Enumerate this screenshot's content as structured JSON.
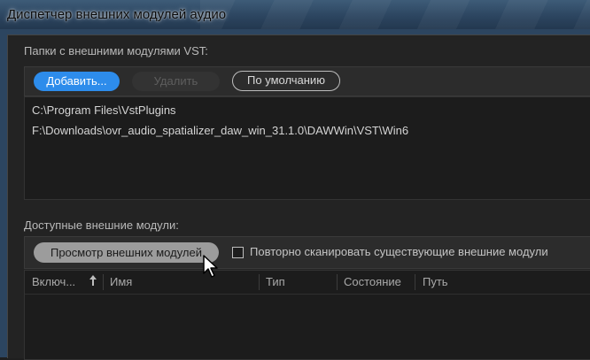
{
  "window": {
    "title": "Диспетчер внешних модулей аудио"
  },
  "vst_folders": {
    "section_label": "Папки с внешними модулями VST:",
    "add_button": "Добавить...",
    "remove_button": "Удалить",
    "default_button": "По умолчанию",
    "paths": [
      "C:\\Program Files\\VstPlugins",
      "F:\\Downloads\\ovr_audio_spatializer_daw_win_31.1.0\\DAWWin\\VST\\Win6"
    ]
  },
  "available_modules": {
    "section_label": "Доступные внешние модули:",
    "scan_button": "Просмотр внешних модулей",
    "rescan_checkbox_label": "Повторно сканировать существующие внешние модули",
    "rescan_checked": false,
    "columns": [
      "Включ...",
      "Имя",
      "Тип",
      "Состояние",
      "Путь"
    ],
    "sort_column": "Имя",
    "sort_direction": "ascending"
  },
  "colors": {
    "accent": "#2d8ceb",
    "background": "#232323",
    "title_bar": "#2c4560"
  },
  "icons": {
    "sort": "arrow-up-icon",
    "cursor": "mouse-pointer-icon"
  }
}
